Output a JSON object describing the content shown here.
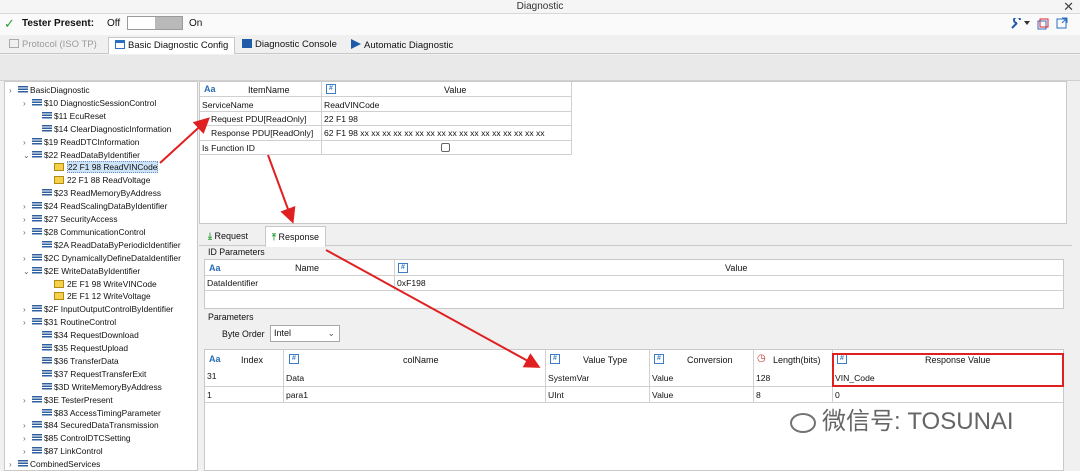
{
  "window": {
    "title": "Diagnostic",
    "close": "✕"
  },
  "tester": {
    "label": "Tester Present:",
    "off": "Off",
    "on": "On"
  },
  "tabs": [
    {
      "label": "Protocol (ISO TP)"
    },
    {
      "label": "Basic Diagnostic Config"
    },
    {
      "label": "Diagnostic Console"
    },
    {
      "label": "Automatic Diagnostic"
    }
  ],
  "tree": {
    "items": [
      {
        "label": "BasicDiagnostic"
      },
      {
        "label": "$10 DiagnosticSessionControl"
      },
      {
        "label": "$11 EcuReset"
      },
      {
        "label": "$14 ClearDiagnosticInformation"
      },
      {
        "label": "$19 ReadDTCInformation"
      },
      {
        "label": "$22 ReadDataByIdentifier"
      },
      {
        "label": "22 F1 98 ReadVINCode"
      },
      {
        "label": "22 F1 88 ReadVoltage"
      },
      {
        "label": "$23 ReadMemoryByAddress"
      },
      {
        "label": "$24 ReadScalingDataByIdentifier"
      },
      {
        "label": "$27 SecurityAccess"
      },
      {
        "label": "$28 CommunicationControl"
      },
      {
        "label": "$2A ReadDataByPeriodicIdentifier"
      },
      {
        "label": "$2C DynamicallyDefineDataIdentifier"
      },
      {
        "label": "$2E WriteDataByIdentifier"
      },
      {
        "label": "2E F1 98 WriteVINCode"
      },
      {
        "label": "2E F1 12 WriteVoltage"
      },
      {
        "label": "$2F InputOutputControlByIdentifier"
      },
      {
        "label": "$31 RoutineControl"
      },
      {
        "label": "$34 RequestDownload"
      },
      {
        "label": "$35 RequestUpload"
      },
      {
        "label": "$36 TransferData"
      },
      {
        "label": "$37 RequestTransferExit"
      },
      {
        "label": "$3D WriteMemoryByAddress"
      },
      {
        "label": "$3E TesterPresent"
      },
      {
        "label": "$83 AccessTimingParameter"
      },
      {
        "label": "$84 SecuredDataTransmission"
      },
      {
        "label": "$85 ControlDTCSetting"
      },
      {
        "label": "$87 LinkControl"
      },
      {
        "label": "CombinedServices"
      }
    ]
  },
  "itemgrid": {
    "col_item": "ItemName",
    "col_value": "Value",
    "rows": [
      {
        "name": "ServiceName",
        "value": "ReadVINCode"
      },
      {
        "name": "Request  PDU[ReadOnly]",
        "value": "22 F1 98"
      },
      {
        "name": "Response PDU[ReadOnly]",
        "value": "62 F1 98 xx xx xx xx xx xx xx xx xx xx xx xx xx xx xx xx xx"
      },
      {
        "name": "Is Function ID",
        "value": ""
      }
    ]
  },
  "subtabs": {
    "request": "Request",
    "response": "Response"
  },
  "id_params": {
    "title": "ID Parameters",
    "col_name": "Name",
    "col_value": "Value",
    "row": {
      "name": "DataIdentifier",
      "value": "0xF198"
    }
  },
  "params": {
    "title": "Parameters",
    "byte_order_label": "Byte Order",
    "byte_order_value": "Intel",
    "columns": [
      "Index",
      "colName",
      "Value Type",
      "Conversion",
      "Length(bits)",
      "Response Value"
    ],
    "rows": [
      {
        "index": "31",
        "colName": "Data",
        "valueType": "SystemVar",
        "conversion": "Value",
        "length": "128",
        "response": "VIN_Code"
      },
      {
        "index": "1",
        "colName": "para1",
        "valueType": "UInt",
        "conversion": "Value",
        "length": "8",
        "response": "0"
      }
    ]
  },
  "watermark": {
    "text": "微信号: TOSUNAI"
  },
  "colors": {
    "accent": "#2b6cb3",
    "annotation": "#e02020"
  }
}
